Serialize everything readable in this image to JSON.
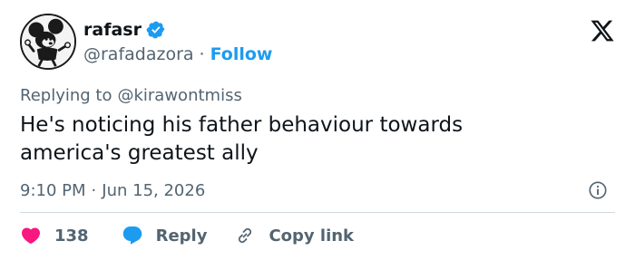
{
  "author": {
    "name": "rafasr",
    "handle": "@rafadazora",
    "separator": "·",
    "follow_label": "Follow",
    "verified": true,
    "verified_color": "#1d9bf0"
  },
  "reply": {
    "prefix": "Replying to",
    "handle": "@kirawontmiss"
  },
  "tweet": {
    "line1": "He's noticing his father behaviour towards",
    "line2": "america's greatest ally"
  },
  "meta": {
    "time": "9:10 PM",
    "separator": "·",
    "date": "Jun 15, 2026"
  },
  "actions": {
    "like_count": "138",
    "reply_label": "Reply",
    "copy_label": "Copy link"
  },
  "icons": {
    "platform": "x-logo-icon",
    "verified": "verified-badge-icon",
    "info": "info-icon",
    "like": "heart-icon",
    "reply": "reply-bubble-icon",
    "copy": "link-icon"
  },
  "colors": {
    "accent": "#1d9bf0",
    "like": "#f91880",
    "muted": "#536471",
    "text": "#0f1419"
  }
}
